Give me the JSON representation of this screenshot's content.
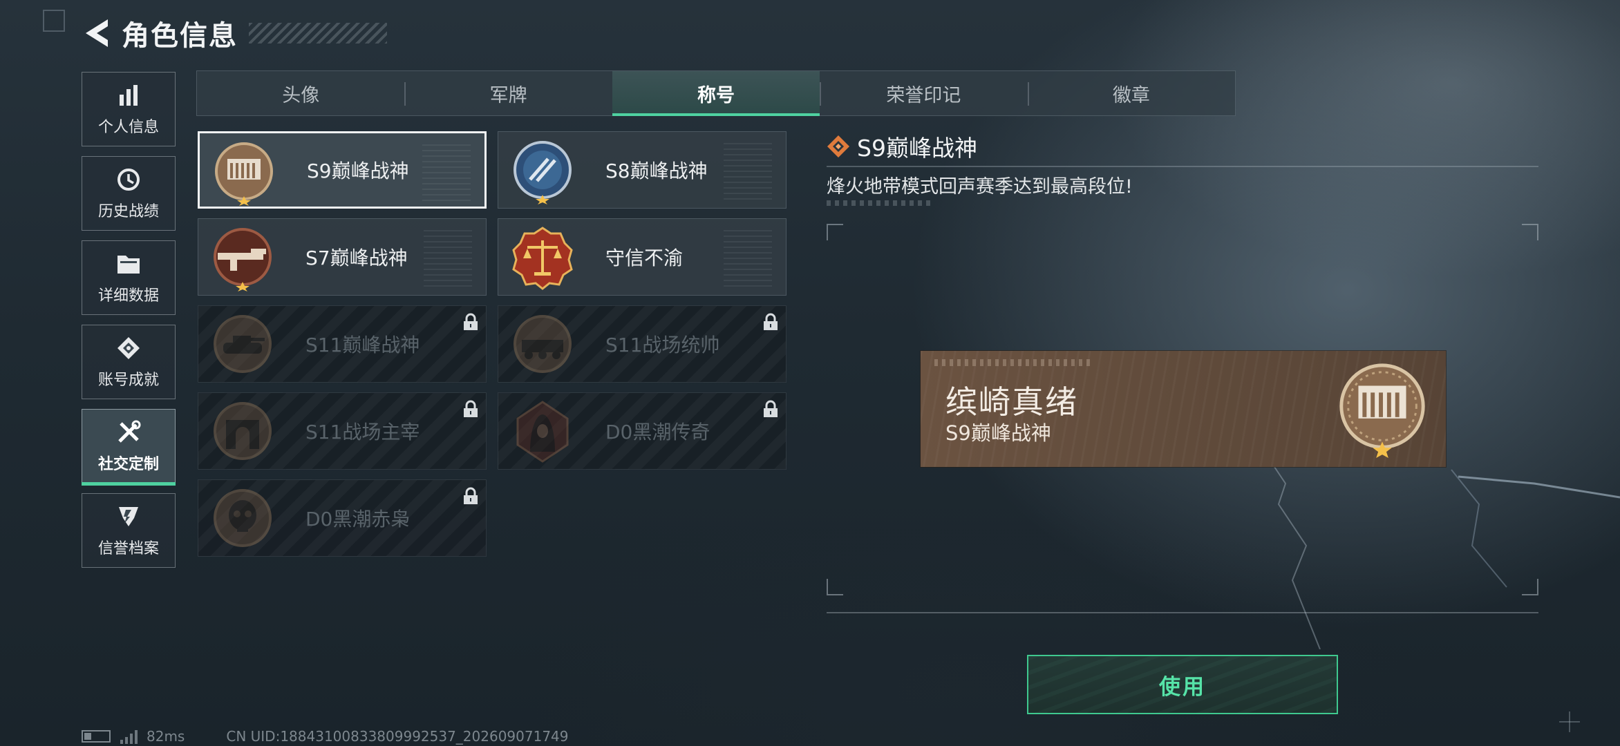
{
  "header": {
    "title": "角色信息"
  },
  "sidebar": {
    "items": [
      {
        "label": "个人信息",
        "icon": "bar-chart-icon",
        "active": false
      },
      {
        "label": "历史战绩",
        "icon": "clock-history-icon",
        "active": false
      },
      {
        "label": "详细数据",
        "icon": "folder-icon",
        "active": false
      },
      {
        "label": "账号成就",
        "icon": "achievement-icon",
        "active": false
      },
      {
        "label": "社交定制",
        "icon": "tools-icon",
        "active": true
      },
      {
        "label": "信誉档案",
        "icon": "credit-shield-icon",
        "active": false
      }
    ]
  },
  "tabs": [
    {
      "label": "头像",
      "active": false
    },
    {
      "label": "军牌",
      "active": false
    },
    {
      "label": "称号",
      "active": true
    },
    {
      "label": "荣誉印记",
      "active": false
    },
    {
      "label": "徽章",
      "active": false
    }
  ],
  "titles": [
    {
      "name": "S9巅峰战神",
      "locked": false,
      "selected": true,
      "emblem": "s9-fortress-emblem-icon"
    },
    {
      "name": "S8巅峰战神",
      "locked": false,
      "selected": false,
      "emblem": "s8-blue-emblem-icon"
    },
    {
      "name": "S7巅峰战神",
      "locked": false,
      "selected": false,
      "emblem": "s7-rifle-emblem-icon"
    },
    {
      "name": "守信不渝",
      "locked": false,
      "selected": false,
      "emblem": "scales-emblem-icon"
    },
    {
      "name": "S11巅峰战神",
      "locked": true,
      "selected": false,
      "emblem": "s11-tank-emblem-icon"
    },
    {
      "name": "S11战场统帅",
      "locked": true,
      "selected": false,
      "emblem": "s11-apc-emblem-icon"
    },
    {
      "name": "S11战场主宰",
      "locked": true,
      "selected": false,
      "emblem": "s11-arch-emblem-icon"
    },
    {
      "name": "D0黑潮传奇",
      "locked": true,
      "selected": false,
      "emblem": "d0-hooded-emblem-icon"
    },
    {
      "name": "D0黑潮赤枭",
      "locked": true,
      "selected": false,
      "emblem": "d0-skull-emblem-icon"
    }
  ],
  "detail": {
    "name": "S9巅峰战神",
    "description": "烽火地带模式回声赛季达到最高段位!",
    "preview": {
      "player_name": "缤崎真绪",
      "title": "S9巅峰战神"
    },
    "use_label": "使用"
  },
  "status": {
    "ping": "82ms",
    "uid": "CN UID:18843100833809992537_202609071749"
  },
  "colors": {
    "accent": "#4fd1a0",
    "title_icon": "#e07b3c",
    "plate": "#604b3b"
  }
}
